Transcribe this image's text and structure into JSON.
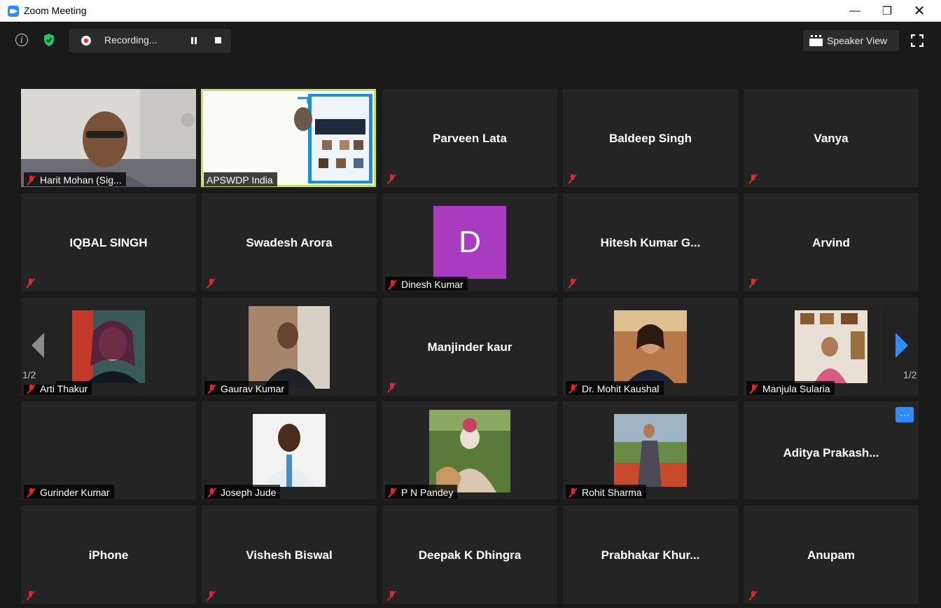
{
  "window": {
    "title": "Zoom Meeting",
    "minimize": "—",
    "restore": "❐",
    "close": "✕"
  },
  "toolbar": {
    "recording_label": "Recording...",
    "view_label": "Speaker View"
  },
  "pagination": {
    "left": "1/2",
    "right": "1/2"
  },
  "colors": {
    "accent": "#2d8cff",
    "active_speaker": "#c7e35a",
    "mute": "#e02828",
    "avatar_d": "#a83bbf"
  },
  "tiles": [
    {
      "name": "Harit Mohan (Sig...",
      "type": "video"
    },
    {
      "name": "APSWDP India",
      "type": "screen-share"
    },
    {
      "name": "Parveen Lata",
      "type": "name-only"
    },
    {
      "name": "Baldeep Singh",
      "type": "name-only"
    },
    {
      "name": "Vanya",
      "type": "name-only"
    },
    {
      "name": "IQBAL SINGH",
      "type": "name-only"
    },
    {
      "name": "Swadesh Arora",
      "type": "name-only"
    },
    {
      "name": "Dinesh Kumar",
      "type": "avatar",
      "avatar_letter": "D"
    },
    {
      "name": "Hitesh Kumar G...",
      "type": "name-only"
    },
    {
      "name": "Arvind",
      "type": "name-only"
    },
    {
      "name": "Arti Thakur",
      "type": "photo"
    },
    {
      "name": "Gaurav Kumar",
      "type": "photo"
    },
    {
      "name": "Manjinder kaur",
      "type": "name-only"
    },
    {
      "name": "Dr. Mohit Kaushal",
      "type": "photo"
    },
    {
      "name": "Manjula Sularia",
      "type": "photo"
    },
    {
      "name": "Gurinder Kumar",
      "type": "empty"
    },
    {
      "name": "Joseph Jude",
      "type": "photo"
    },
    {
      "name": "P N Pandey",
      "type": "photo"
    },
    {
      "name": "Rohit Sharma",
      "type": "photo"
    },
    {
      "name": "Aditya  Prakash...",
      "type": "name-only",
      "more_label": "···"
    },
    {
      "name": "iPhone",
      "type": "name-only"
    },
    {
      "name": "Vishesh Biswal",
      "type": "name-only"
    },
    {
      "name": "Deepak K Dhingra",
      "type": "name-only"
    },
    {
      "name": "Prabhakar  Khur...",
      "type": "name-only"
    },
    {
      "name": "Anupam",
      "type": "name-only"
    }
  ]
}
